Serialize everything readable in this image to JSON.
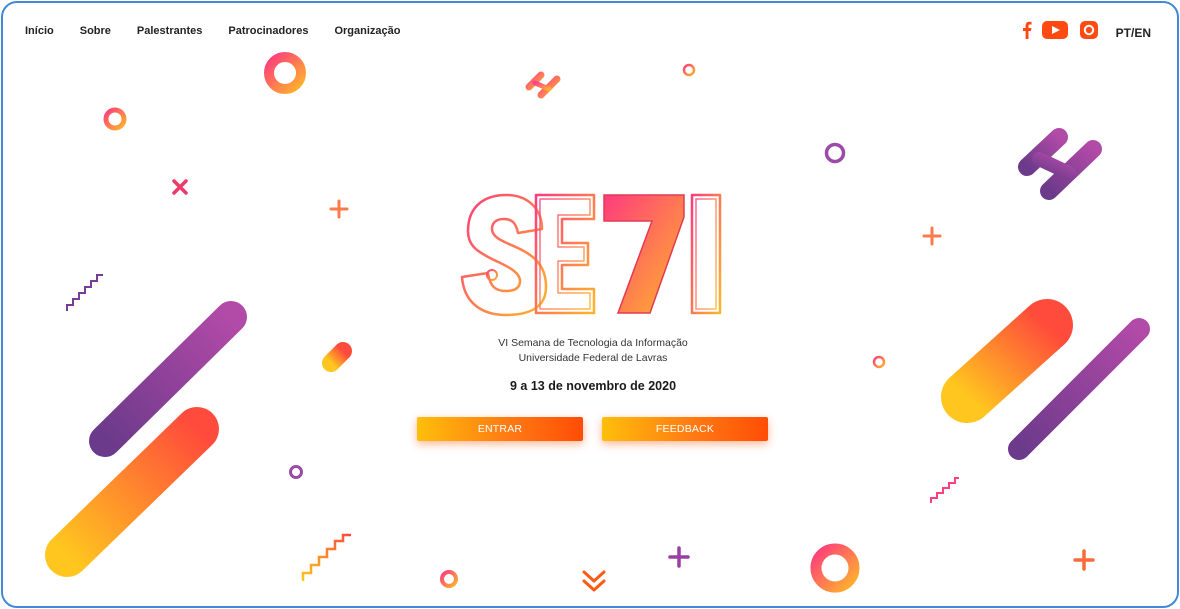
{
  "nav": {
    "items": [
      {
        "label": "Início"
      },
      {
        "label": "Sobre"
      },
      {
        "label": "Palestrantes"
      },
      {
        "label": "Patrocinadores"
      },
      {
        "label": "Organização"
      }
    ]
  },
  "social": {
    "icons": [
      "facebook-icon",
      "youtube-icon",
      "instagram-icon"
    ],
    "language_toggle": "PT/EN"
  },
  "hero": {
    "logo_text": "SE7I",
    "subtitle_line1": "VI Semana de Tecnologia da Informação",
    "subtitle_line2": "Universidade Federal de Lavras",
    "dates": "9 a 13 de novembro de 2020"
  },
  "buttons": {
    "entrar_label": "ENTRAR",
    "feedback_label": "FEEDBACK"
  },
  "colors": {
    "accent_orange": "#ff5a0a",
    "accent_yellow": "#ffbe0a",
    "accent_pink": "#e8336e",
    "accent_purple": "#8b3d99",
    "frame_border": "#3f8bd9"
  }
}
